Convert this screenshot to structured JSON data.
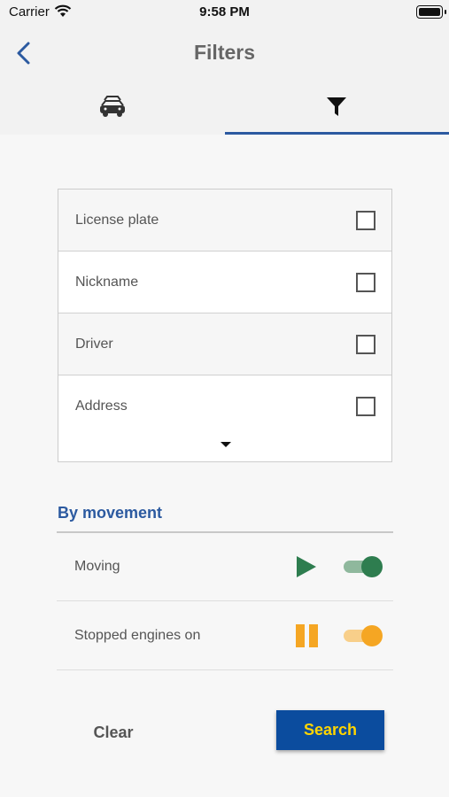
{
  "status_bar": {
    "carrier": "Carrier",
    "time": "9:58 PM"
  },
  "nav": {
    "title": "Filters"
  },
  "tabs": [
    {
      "icon": "cars-icon",
      "active": false
    },
    {
      "icon": "funnel-icon",
      "active": true
    }
  ],
  "filter_fields": [
    {
      "label": "License plate",
      "checked": false
    },
    {
      "label": "Nickname",
      "checked": false
    },
    {
      "label": "Driver",
      "checked": false
    },
    {
      "label": "Address",
      "checked": false
    }
  ],
  "movement": {
    "title": "By movement",
    "items": [
      {
        "label": "Moving",
        "icon": "play-icon",
        "color": "#2e7d4f",
        "enabled": true
      },
      {
        "label": "Stopped engines on",
        "icon": "pause-icon",
        "color": "#f5a623",
        "enabled": true
      }
    ]
  },
  "actions": {
    "clear_label": "Clear",
    "search_label": "Search"
  },
  "colors": {
    "accent": "#2c5aa0",
    "search_bg": "#0b4c9e",
    "search_text": "#ffd500"
  }
}
